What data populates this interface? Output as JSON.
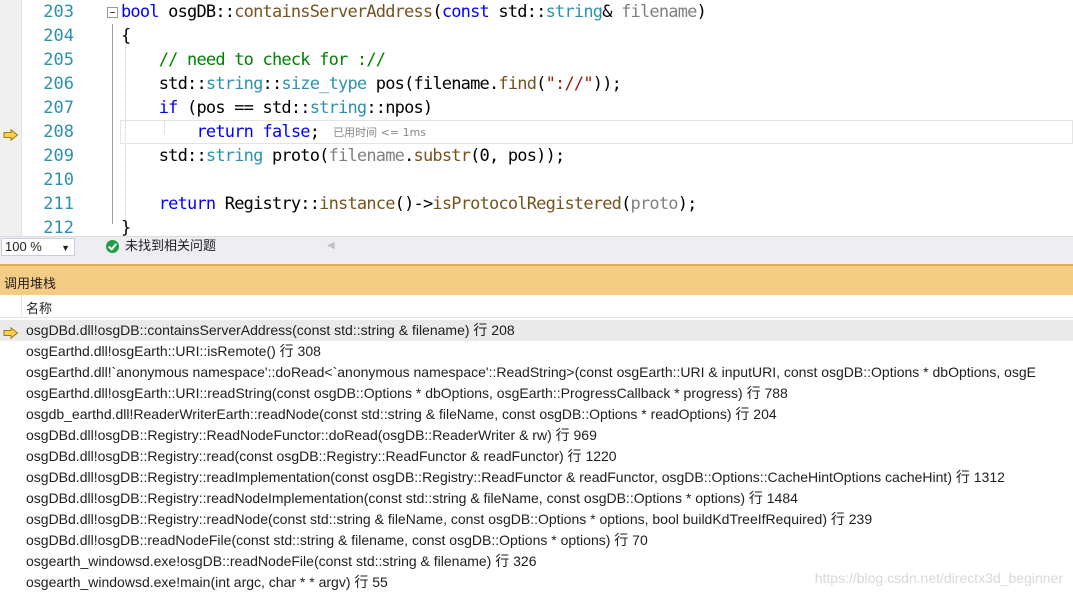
{
  "editor": {
    "lines": [
      {
        "no": "203",
        "tokens": [
          {
            "t": "bool",
            "c": "kw"
          },
          {
            "t": " osgDB::",
            "c": ""
          },
          {
            "t": "containsServerAddress",
            "c": "fn"
          },
          {
            "t": "(",
            "c": ""
          },
          {
            "t": "const",
            "c": "kw"
          },
          {
            "t": " std::",
            "c": ""
          },
          {
            "t": "string",
            "c": "ty"
          },
          {
            "t": "& ",
            "c": ""
          },
          {
            "t": "filename",
            "c": "prm"
          },
          {
            "t": ")",
            "c": ""
          }
        ]
      },
      {
        "no": "204",
        "tokens": [
          {
            "t": "{",
            "c": ""
          }
        ]
      },
      {
        "no": "205",
        "tokens": [
          {
            "t": "    ",
            "c": ""
          },
          {
            "t": "// need to check for ://",
            "c": "cm"
          }
        ]
      },
      {
        "no": "206",
        "tokens": [
          {
            "t": "    std::",
            "c": ""
          },
          {
            "t": "string",
            "c": "ty"
          },
          {
            "t": "::",
            "c": ""
          },
          {
            "t": "size_type",
            "c": "ty"
          },
          {
            "t": " pos(filename.",
            "c": ""
          },
          {
            "t": "find",
            "c": "fn"
          },
          {
            "t": "(",
            "c": ""
          },
          {
            "t": "\"://\"",
            "c": "str"
          },
          {
            "t": "));",
            "c": ""
          }
        ]
      },
      {
        "no": "207",
        "tokens": [
          {
            "t": "    ",
            "c": ""
          },
          {
            "t": "if",
            "c": "kw"
          },
          {
            "t": " (pos == std::",
            "c": ""
          },
          {
            "t": "string",
            "c": "ty"
          },
          {
            "t": "::npos)",
            "c": ""
          }
        ]
      },
      {
        "no": "208",
        "tokens": [
          {
            "t": "        ",
            "c": ""
          },
          {
            "t": "return",
            "c": "kw"
          },
          {
            "t": " ",
            "c": ""
          },
          {
            "t": "false",
            "c": "kw"
          },
          {
            "t": ";",
            "c": ""
          }
        ],
        "elapsed": "已用时间 <= 1ms"
      },
      {
        "no": "209",
        "tokens": [
          {
            "t": "    std::",
            "c": ""
          },
          {
            "t": "string",
            "c": "ty"
          },
          {
            "t": " ",
            "c": ""
          },
          {
            "t": "proto",
            "c": "mac"
          },
          {
            "t": "(",
            "c": ""
          },
          {
            "t": "filename",
            "c": "prm"
          },
          {
            "t": ".",
            "c": ""
          },
          {
            "t": "substr",
            "c": "fn"
          },
          {
            "t": "(0, pos));",
            "c": ""
          }
        ]
      },
      {
        "no": "210",
        "tokens": []
      },
      {
        "no": "211",
        "tokens": [
          {
            "t": "    ",
            "c": ""
          },
          {
            "t": "return",
            "c": "kw"
          },
          {
            "t": " Registry::",
            "c": ""
          },
          {
            "t": "instance",
            "c": "fn"
          },
          {
            "t": "()->",
            "c": ""
          },
          {
            "t": "isProtocolRegistered",
            "c": "fn"
          },
          {
            "t": "(",
            "c": ""
          },
          {
            "t": "proto",
            "c": "prm"
          },
          {
            "t": ");",
            "c": ""
          }
        ]
      },
      {
        "no": "212",
        "tokens": [
          {
            "t": "}",
            "c": ""
          }
        ]
      }
    ],
    "current_line_index": 5
  },
  "status": {
    "zoom": "100 %",
    "issues_text": "未找到相关问题"
  },
  "callstack": {
    "title": "调用堆栈",
    "column_name": "名称",
    "frames": [
      "osgDBd.dll!osgDB::containsServerAddress(const std::string & filename) 行 208",
      "osgEarthd.dll!osgEarth::URI::isRemote() 行 308",
      "osgEarthd.dll!`anonymous namespace'::doRead<`anonymous namespace'::ReadString>(const osgEarth::URI & inputURI, const osgDB::Options * dbOptions, osgE",
      "osgEarthd.dll!osgEarth::URI::readString(const osgDB::Options * dbOptions, osgEarth::ProgressCallback * progress) 行 788",
      "osgdb_earthd.dll!ReaderWriterEarth::readNode(const std::string & fileName, const osgDB::Options * readOptions) 行 204",
      "osgDBd.dll!osgDB::Registry::ReadNodeFunctor::doRead(osgDB::ReaderWriter & rw) 行 969",
      "osgDBd.dll!osgDB::Registry::read(const osgDB::Registry::ReadFunctor & readFunctor) 行 1220",
      "osgDBd.dll!osgDB::Registry::readImplementation(const osgDB::Registry::ReadFunctor & readFunctor, osgDB::Options::CacheHintOptions cacheHint) 行 1312",
      "osgDBd.dll!osgDB::Registry::readNodeImplementation(const std::string & fileName, const osgDB::Options * options) 行 1484",
      "osgDBd.dll!osgDB::Registry::readNode(const std::string & fileName, const osgDB::Options * options, bool buildKdTreeIfRequired) 行 239",
      "osgDBd.dll!osgDB::readNodeFile(const std::string & filename, const osgDB::Options * options) 行 70",
      "osgearth_windowsd.exe!osgDB::readNodeFile(const std::string & filename) 行 326",
      "osgearth_windowsd.exe!main(int argc, char * * argv) 行 55"
    ],
    "active_frame_index": 0
  },
  "watermark": "https://blog.csdn.net/directx3d_beginner",
  "icons": {
    "current_statement": "current-statement-arrow-icon",
    "no_issues": "check-circle-icon"
  },
  "colors": {
    "arrow_fill": "#f7d24a",
    "arrow_stroke": "#9a7a1a",
    "panel_header": "#f5cc84"
  }
}
